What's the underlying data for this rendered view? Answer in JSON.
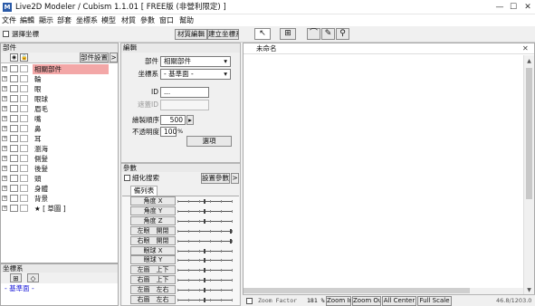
{
  "window": {
    "title": "Live2D Modeler / Cubism 1.1.01 [ FREE版 (非營利限定) ]"
  },
  "menu": [
    "文件",
    "編輯",
    "顯示",
    "部套",
    "坐標系",
    "模型",
    "材質",
    "參數",
    "窗口",
    "幫助"
  ],
  "toolbar": {
    "select_coords_label": "選擇坐標",
    "texture_edit_label": "材質編輯",
    "create_coords_label": "建立坐標系"
  },
  "parts_panel": {
    "title": "部件",
    "settings_label": "部件設置",
    "items": [
      "相關部件",
      "輪",
      "眼",
      "眼球",
      "眉毛",
      "嘴",
      "鼻",
      "耳",
      "瀏海",
      "側髮",
      "後髮",
      "頭",
      "身體",
      "背景",
      "★ [ 草圖 ]"
    ]
  },
  "coord_panel": {
    "title": "坐標系",
    "root_label": "- 基準面 -"
  },
  "edit_panel": {
    "title": "編輯",
    "part_label": "部件",
    "part_value": "相關部件",
    "coord_label": "坐標系",
    "coord_value": "- 基準面 -",
    "id_label": "ID",
    "id_value": "...",
    "clip_label": "遮蓋ID",
    "draw_order_label": "繪製順序",
    "draw_order_value": "500",
    "opacity_label": "不透明度",
    "opacity_value": "100",
    "opacity_unit": "%",
    "select_button": "選項"
  },
  "param_panel": {
    "title": "參數",
    "fine_search_label": "細化搜索",
    "settings_label": "設置參數",
    "tab_label": "備列表",
    "params": [
      {
        "name": "角度 X",
        "value": 0.5
      },
      {
        "name": "角度 Y",
        "value": 0.5
      },
      {
        "name": "角度 Z",
        "value": 0.5
      },
      {
        "name": "左眼　開閉",
        "value": 1.0
      },
      {
        "name": "右眼　開閉",
        "value": 1.0
      },
      {
        "name": "眼球 X",
        "value": 0.5
      },
      {
        "name": "眼球 Y",
        "value": 0.5
      },
      {
        "name": "左眉　上下",
        "value": 0.5
      },
      {
        "name": "右眉　上下",
        "value": 0.5
      },
      {
        "name": "左眉　左右",
        "value": 0.5
      },
      {
        "name": "右眉　左右",
        "value": 0.5
      }
    ]
  },
  "canvas": {
    "title": "未命名"
  },
  "status": {
    "zoom_factor_label": "Zoom Factor",
    "zoom_value": "181 %",
    "zoom_in": "Zoom In",
    "zoom_out": "Zoom Out",
    "all_center": "All Center",
    "full_scale": "Full Scale",
    "coords": "46.8/1203.0"
  },
  "colors": {
    "selected_part": "#f3a7a7",
    "coord_text": "#1a1ad8",
    "accent": "#2a5aa8"
  }
}
